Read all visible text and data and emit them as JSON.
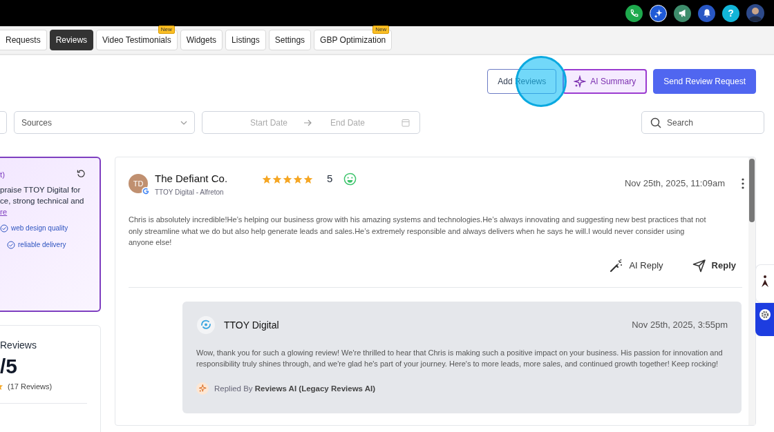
{
  "top_bar": {
    "help_label": "?"
  },
  "tabs": [
    {
      "label": "Requests",
      "selected": false
    },
    {
      "label": "Reviews",
      "selected": true
    },
    {
      "label": "Video Testimonials",
      "selected": false,
      "badge": "New"
    },
    {
      "label": "Widgets",
      "selected": false
    },
    {
      "label": "Listings",
      "selected": false
    },
    {
      "label": "Settings",
      "selected": false
    },
    {
      "label": "GBP Optimization",
      "selected": false,
      "badge": "New"
    }
  ],
  "actions": [
    {
      "label": "Add Reviews",
      "kind": "outline"
    },
    {
      "label": "AI Summary",
      "kind": "ai"
    },
    {
      "label": "Send Review Request",
      "kind": "primary"
    }
  ],
  "filters": {
    "sources_placeholder": "Sources",
    "start_date": "Start Date",
    "end_date": "End Date",
    "search_placeholder": "Search"
  },
  "summary_panel": {
    "title": "t)",
    "lines": [
      "praise TTOY Digital for",
      "ce, strong technical and"
    ],
    "link": "re",
    "tags": [
      "web design quality",
      "reliable delivery"
    ]
  },
  "stats_card": {
    "title": "Reviews",
    "score": "/5",
    "count": "(17 Reviews)"
  },
  "review": {
    "initials": "TD",
    "name": "The Defiant Co.",
    "location": "TTOY Digital - Alfreton",
    "stars": 5,
    "rating": "5",
    "date": "Nov 25th, 2025, 11:09am",
    "text": "Chris is absolutely incredible!He’s helping our business grow with his amazing systems and technologies.He’s always innovating and suggesting new best practices that not only streamline what we do but also help generate leads and sales.He’s extremely responsible and always delivers when he says he will.I would never consider using anyone else!",
    "actions": [
      {
        "label": "AI Reply",
        "kind": "ai"
      },
      {
        "label": "Reply",
        "kind": "reply"
      }
    ],
    "reply": {
      "name": "TTOY Digital",
      "date": "Nov 25th, 2025, 3:55pm",
      "text": "Wow, thank you for such a glowing review! We're thrilled to hear that Chris is making such a positive impact on your business. His passion for innovation and responsibility truly shines through, and we're glad he's part of your journey. Here's to more leads, more sales, and continued growth together! Keep rocking!",
      "replied_by": "Replied By **Reviews AI (Legacy Reviews AI)**"
    }
  }
}
